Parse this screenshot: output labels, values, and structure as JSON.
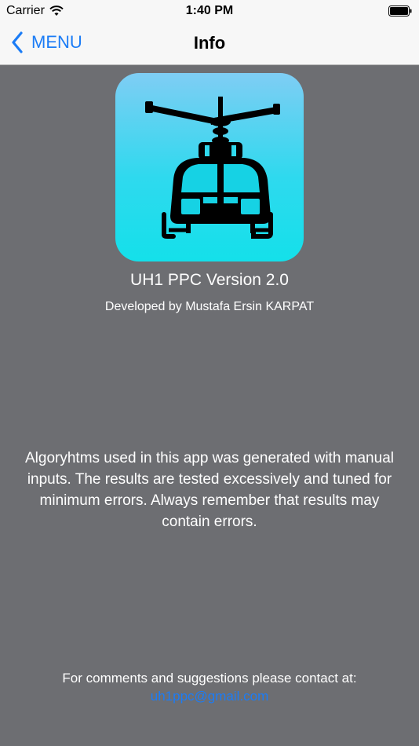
{
  "status_bar": {
    "carrier": "Carrier",
    "time": "1:40 PM"
  },
  "nav": {
    "back_label": "MENU",
    "title": "Info"
  },
  "app": {
    "icon": "helicopter-icon",
    "version": "UH1 PPC Version 2.0",
    "developer": "Developed by Mustafa Ersin KARPAT"
  },
  "disclaimer": " Algoryhtms used in this app was generated with manual inputs. The results are tested excessively and tuned for minimum errors. Always remember that results may contain errors.",
  "contact": {
    "text": "For comments and suggestions please contact at:",
    "email": "uh1ppc@gmail.com"
  },
  "colors": {
    "background": "#6d6e72",
    "nav_background": "#f7f7f7",
    "accent": "#1b7cf6",
    "icon_gradient_top": "#7fcdf4",
    "icon_gradient_bottom": "#14e0ea"
  }
}
